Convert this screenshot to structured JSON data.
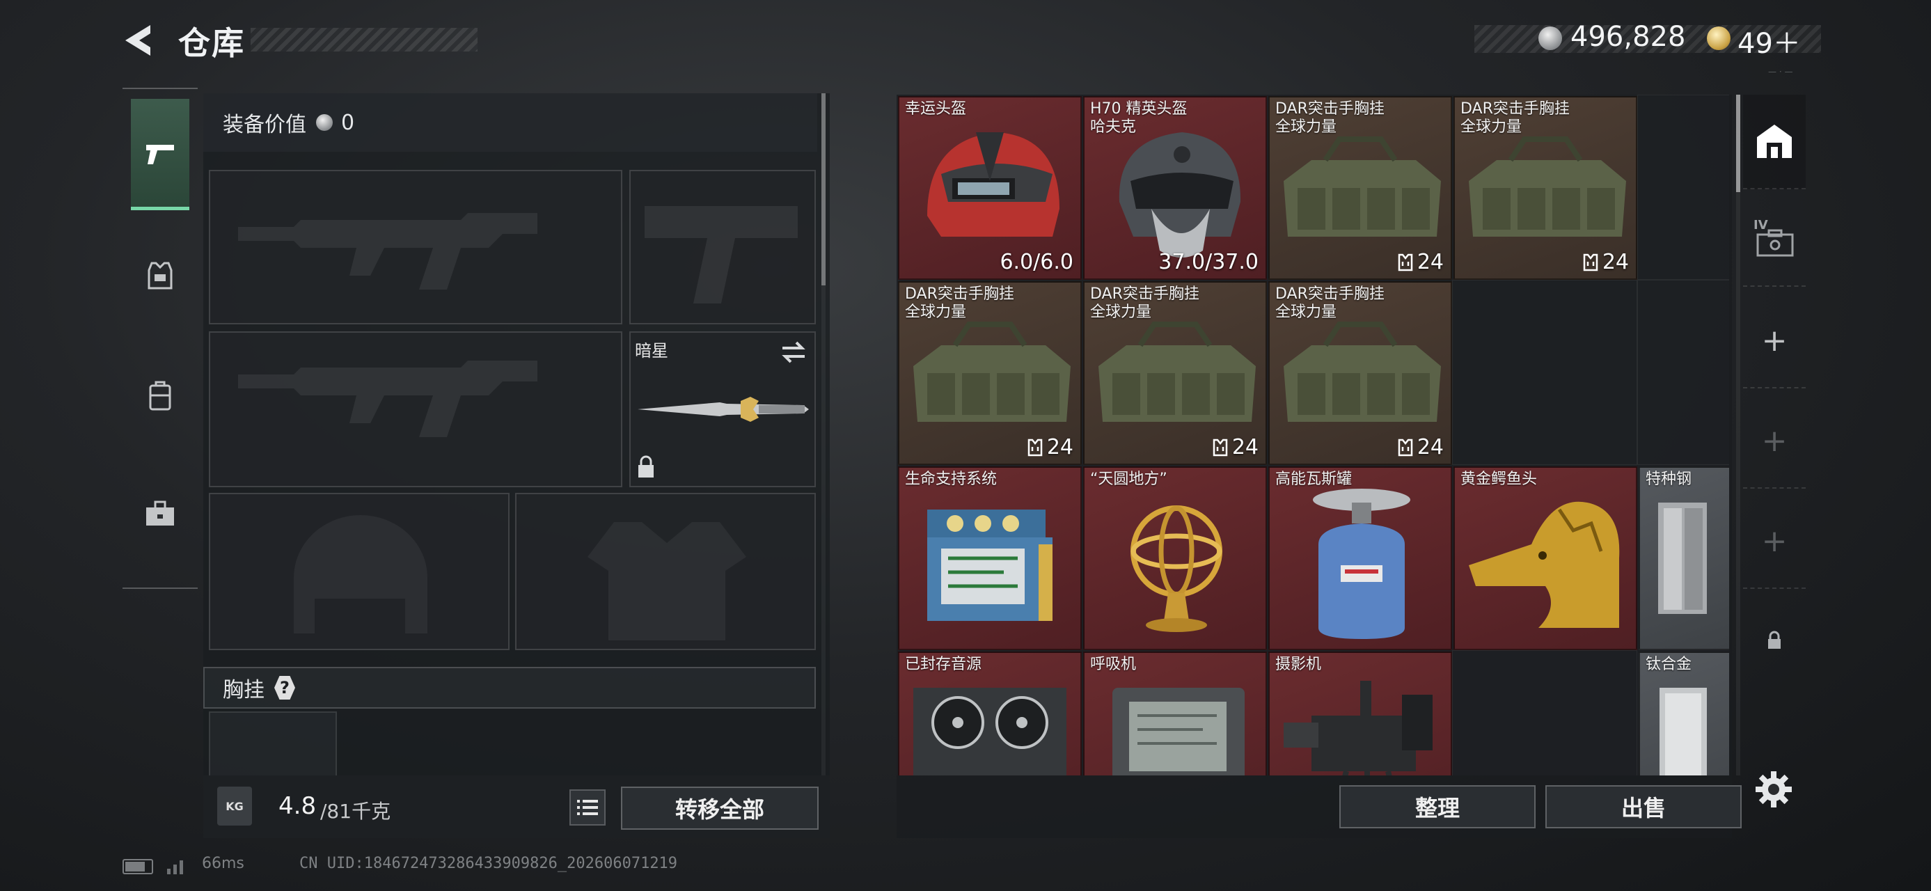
{
  "header": {
    "title": "仓库",
    "currency": "496,828",
    "premium": "49＋"
  },
  "nav": {
    "items": [
      {
        "icon": "pistol-icon",
        "active": true
      },
      {
        "icon": "armor-icon",
        "active": false
      },
      {
        "icon": "backpack-icon",
        "active": false
      },
      {
        "icon": "briefcase-icon",
        "active": false
      }
    ]
  },
  "equipment": {
    "value_label": "装备价值",
    "value": "0",
    "melee_name": "暗星",
    "chest_rig_label": "胸挂",
    "help_glyph": "?",
    "weight_current": "4.8",
    "weight_max": "/81千克",
    "kg_label": "KG",
    "transfer_all_label": "转移全部"
  },
  "storage": {
    "items": [
      {
        "name": "幸运头盔",
        "stat": "6.0/6.0",
        "rarity": "red",
        "icon": "lucky-helmet-image"
      },
      {
        "name": "H70 精英头盔\n哈夫克",
        "stat": "37.0/37.0",
        "rarity": "red",
        "icon": "elite-helmet-image"
      },
      {
        "name": "DAR突击手胸挂\n全球力量",
        "stat": "24",
        "rarity": "brown",
        "icon": "chest-rig-image"
      },
      {
        "name": "DAR突击手胸挂\n全球力量",
        "stat": "24",
        "rarity": "brown",
        "icon": "chest-rig-image"
      },
      {
        "name": "DAR突击手胸挂\n全球力量",
        "stat": "24",
        "rarity": "brown",
        "icon": "chest-rig-image"
      },
      {
        "name": "DAR突击手胸挂\n全球力量",
        "stat": "24",
        "rarity": "brown",
        "icon": "chest-rig-image"
      },
      {
        "name": "DAR突击手胸挂\n全球力量",
        "stat": "24",
        "rarity": "brown",
        "icon": "chest-rig-image"
      },
      {
        "name": "生命支持系统",
        "stat": "",
        "rarity": "red",
        "icon": "life-support-image"
      },
      {
        "name": "“天圆地方”",
        "stat": "",
        "rarity": "red",
        "icon": "armillary-sphere-image"
      },
      {
        "name": "高能瓦斯罐",
        "stat": "",
        "rarity": "red",
        "icon": "gas-tank-image"
      },
      {
        "name": "黄金鳄鱼头",
        "stat": "",
        "rarity": "red",
        "icon": "gold-crocodile-image"
      },
      {
        "name": "特种钢",
        "stat": "",
        "rarity": "gray",
        "icon": "special-steel-image"
      },
      {
        "name": "已封存音源",
        "stat": "",
        "rarity": "red",
        "icon": "reel-recorder-image"
      },
      {
        "name": "呼吸机",
        "stat": "",
        "rarity": "red",
        "icon": "ventilator-image"
      },
      {
        "name": "摄影机",
        "stat": "",
        "rarity": "red",
        "icon": "camera-image"
      },
      {
        "name": "钛合金",
        "stat": "",
        "rarity": "gray",
        "icon": "titanium-image"
      }
    ],
    "organize_label": "整理",
    "sell_label": "出售"
  },
  "right_tabs": {
    "case_tab_label": "IV",
    "add_glyph": "+",
    "top_tiny_text": "— · —"
  },
  "status": {
    "ping": "66ms",
    "uid": "CN UID:18467247328643390982​6_202606071219"
  },
  "colors": {
    "accent_green": "#78d8a8",
    "rarity_red": "#6a2c2f",
    "rarity_brown": "#4f3f34",
    "rarity_gray": "#55595e"
  }
}
